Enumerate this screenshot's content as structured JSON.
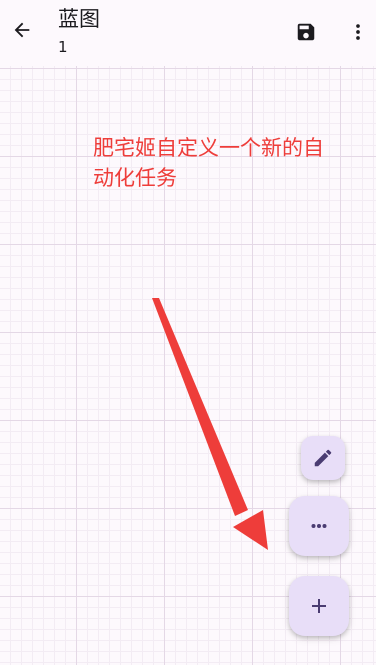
{
  "appbar": {
    "title": "蓝图",
    "subtitle": "1",
    "icons": {
      "back": "arrow-back-icon",
      "save": "save-icon",
      "more": "more-vert-icon"
    }
  },
  "annotation": {
    "text": "肥宅姬自定义一个新的自动化任务",
    "color": "#ee3d3a"
  },
  "fabs": {
    "edit_icon": "pencil-icon",
    "more_icon": "more-horiz-icon",
    "add_icon": "plus-icon"
  },
  "colors": {
    "background": "#fdf9fd",
    "grid_major": "#e4d8e6",
    "fab_container": "#e8def8",
    "fab_icon": "#4a3c72",
    "arrow": "#ee3d3a"
  }
}
